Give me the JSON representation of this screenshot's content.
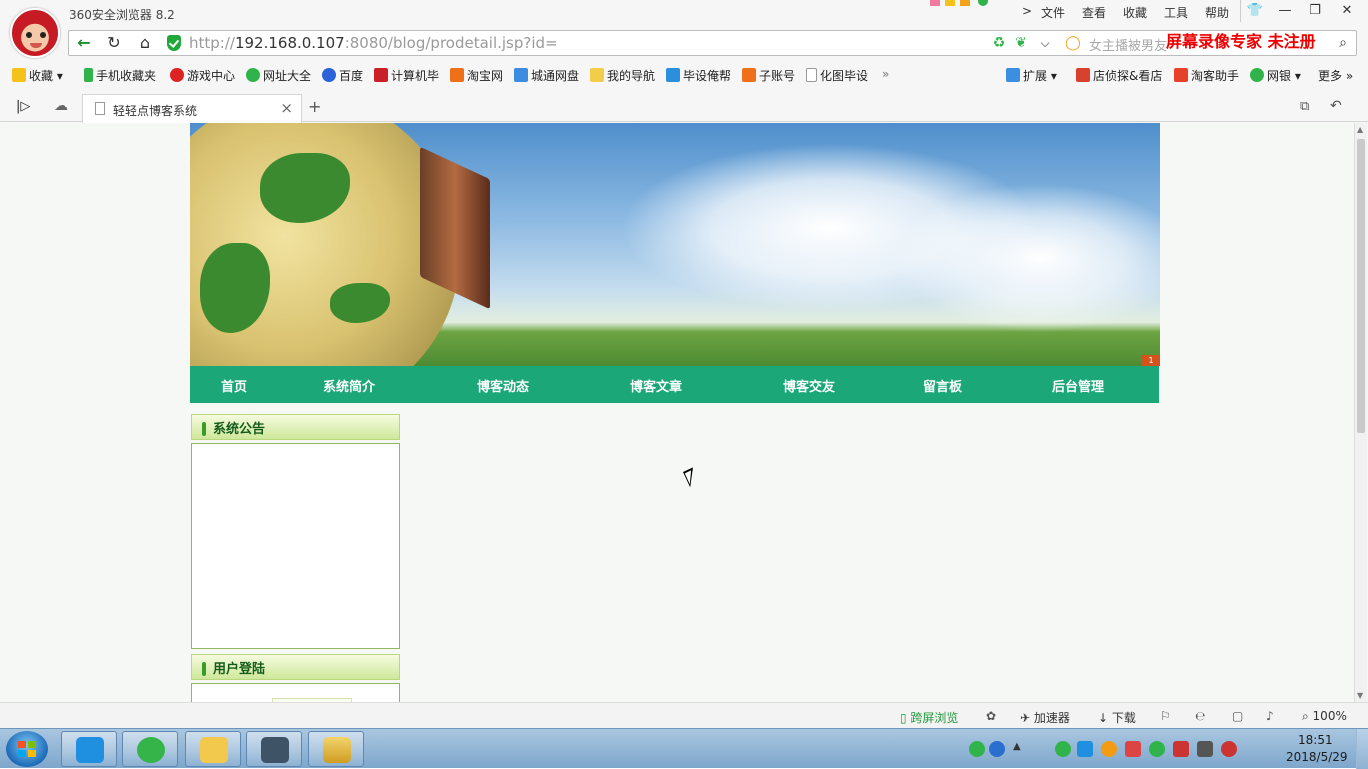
{
  "app": {
    "title": "360安全浏览器 8.2"
  },
  "menu": [
    "文件",
    "查看",
    "收藏",
    "工具",
    "帮助"
  ],
  "window_controls": {
    "minimize": "—",
    "maximize": "❐",
    "close": "✕"
  },
  "address": {
    "url_prefix": "http://",
    "url_host": "192.168.0.107",
    "url_rest": ":8080/blog/prodetail.jsp?id=",
    "search_placeholder": "女主播被男友"
  },
  "watermark": "屏幕录像专家 未注册",
  "bookmarks": [
    "收藏",
    "手机收藏夹",
    "游戏中心",
    "网址大全",
    "百度",
    "计算机毕",
    "淘宝网",
    "城通网盘",
    "我的导航",
    "毕设俺帮",
    "子账号",
    "化图毕设",
    "扩展",
    "店侦探&看店",
    "淘客助手",
    "网银",
    "更多"
  ],
  "tab": {
    "title": "轻轻点博客系统"
  },
  "page": {
    "banner_badge": "1",
    "nav": [
      "首页",
      "系统简介",
      "博客动态",
      "博客文章",
      "博客交友",
      "留言板",
      "后台管理"
    ],
    "notice_title": "系统公告",
    "login_title": "用户登陆"
  },
  "statusbar": {
    "cross_screen": "跨屏浏览",
    "accelerator": "加速器",
    "download": "下载",
    "zoom": "100%"
  },
  "taskbar": {
    "time": "18:51",
    "date": "2018/5/29"
  },
  "colors": {
    "nav_green": "#1ba777",
    "accent_red": "#e00000",
    "taskbar_blue": "#7ea7cc"
  }
}
